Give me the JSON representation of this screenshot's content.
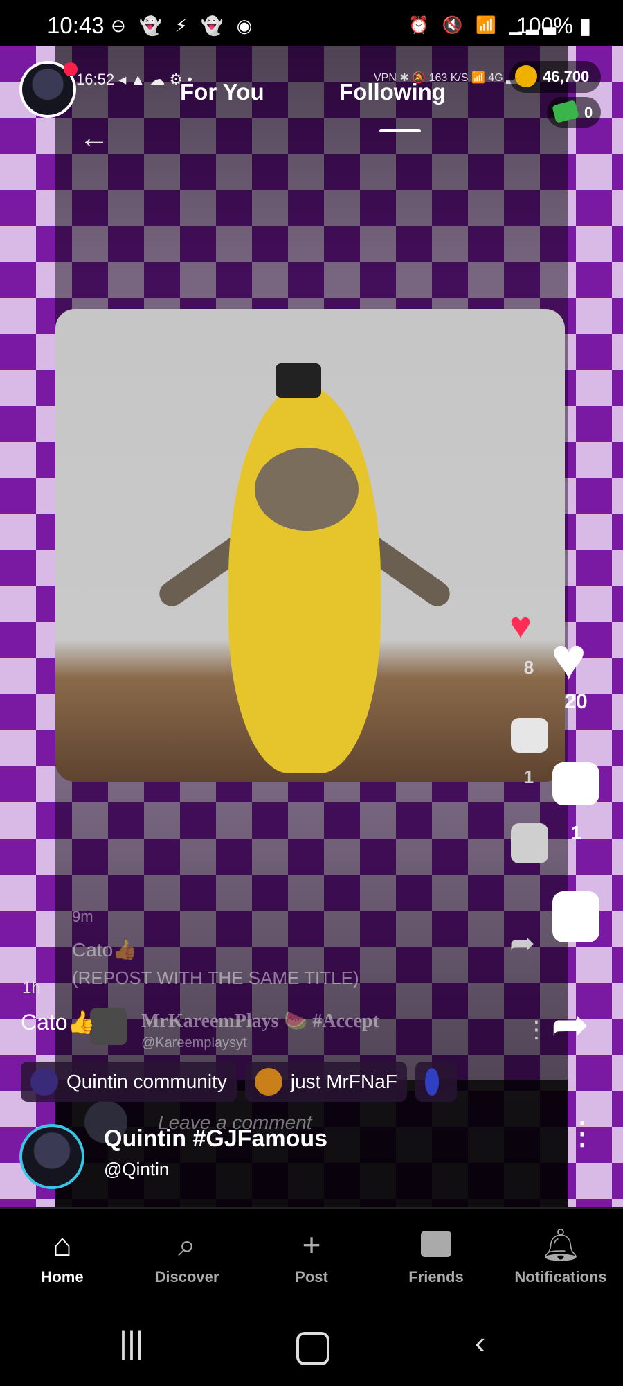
{
  "status_bar": {
    "time": "10:43",
    "left_icons": "⊖ 👻 ⚡ 👻 ◉",
    "right_icons": "⏰ 🔇 📶 ▁▂▃",
    "battery": "100%"
  },
  "inner_status": {
    "time": "16:52",
    "icons": "◂ ▲ ☁ ⚙ •",
    "right": "VPN ✱ 🔕 163 K/S 📶 4G ▂▃"
  },
  "header": {
    "tabs": [
      {
        "label": "For You",
        "active": false
      },
      {
        "label": "Following",
        "active": true
      }
    ],
    "coins": "46,700",
    "cash": "0"
  },
  "inner_post": {
    "likes": "8",
    "comments": "1",
    "time_ago": "9m",
    "caption": "Cato👍",
    "subtitle": "(REPOST WITH THE SAME TITLE)",
    "account_name": "MrKareemPlays 🍉 #Accept",
    "account_handle": "@Kareemplaysyt",
    "comment_placeholder": "Leave a comment"
  },
  "actions": {
    "likes": "20",
    "comments": "1"
  },
  "post": {
    "time_ago": "1h",
    "caption": "Cato👍",
    "communities": [
      "Quintin community",
      "just MrFNaF"
    ],
    "author_name": "Quintin #GJFamous",
    "author_handle": "@Qintin"
  },
  "nav": [
    {
      "label": "Home",
      "icon": "home-icon",
      "active": true
    },
    {
      "label": "Discover",
      "icon": "search-icon",
      "active": false
    },
    {
      "label": "Post",
      "icon": "plus-icon",
      "active": false
    },
    {
      "label": "Friends",
      "icon": "chat-icon",
      "active": false
    },
    {
      "label": "Notifications",
      "icon": "bell-icon",
      "active": false
    }
  ],
  "colors": {
    "like": "#ff2d55",
    "accent_purple": "#7a1aa3"
  }
}
